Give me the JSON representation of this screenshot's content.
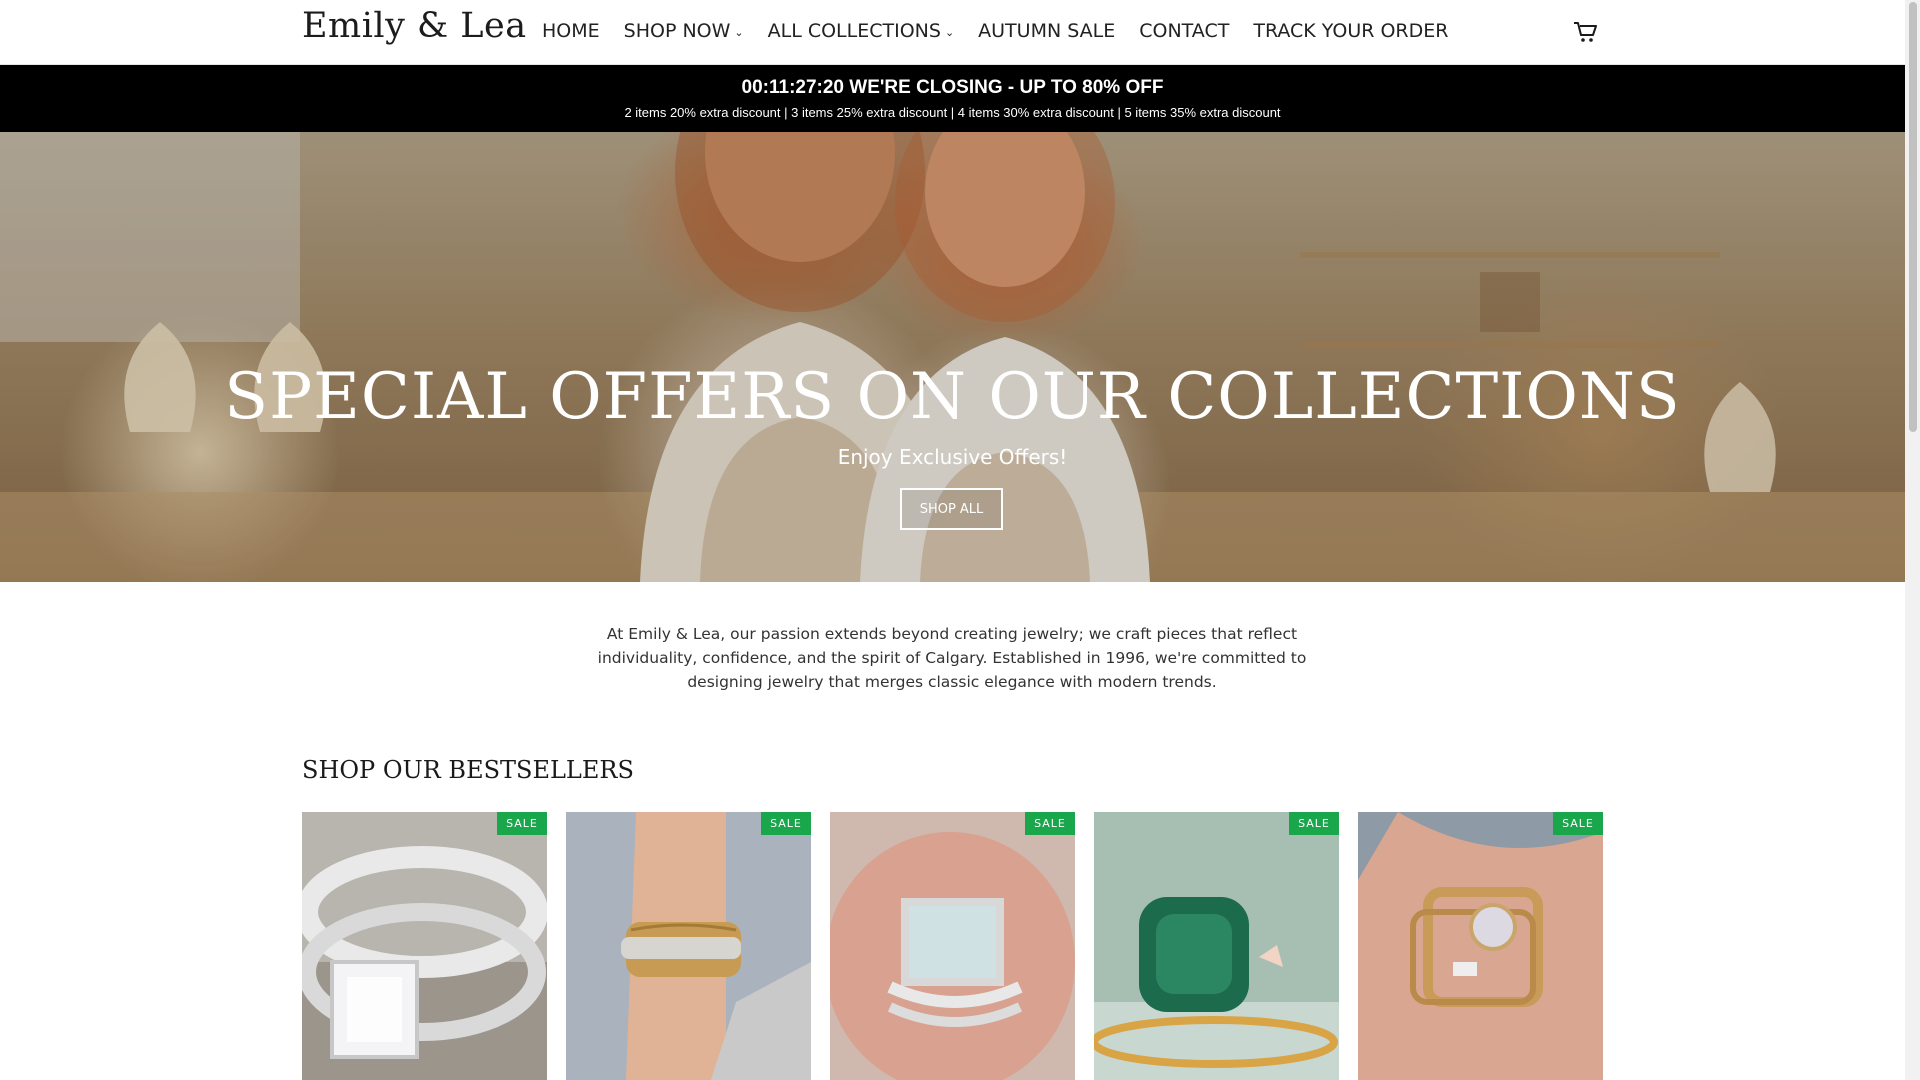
{
  "header": {
    "logo": "Emily & Lea",
    "nav": [
      {
        "label": "HOME",
        "dropdown": false
      },
      {
        "label": "SHOP NOW",
        "dropdown": true
      },
      {
        "label": "ALL COLLECTIONS",
        "dropdown": true
      },
      {
        "label": "AUTUMN SALE",
        "dropdown": false
      },
      {
        "label": "CONTACT",
        "dropdown": false
      },
      {
        "label": "TRACK YOUR ORDER",
        "dropdown": false
      }
    ],
    "cart_icon": "shopping-cart-icon"
  },
  "announcement": {
    "main": "00:11:27:20 WE'RE CLOSING - UP TO 80% OFF",
    "sub": "2 items 20% extra discount | 3 items 25% extra discount | 4 items 30% extra discount | 5 items 35% extra discount"
  },
  "hero": {
    "title": "SPECIAL OFFERS ON OUR COLLECTIONS",
    "subtitle": "Enjoy Exclusive Offers!",
    "button": "SHOP ALL"
  },
  "intro": {
    "text": "At Emily & Lea, our passion extends beyond creating jewelry; we craft pieces that reflect individuality, confidence, and the spirit of Calgary. Established in 1996, we're committed to designing jewelry that merges classic elegance with modern trends."
  },
  "bestsellers": {
    "title": "SHOP OUR BESTSELLERS",
    "products": [
      {
        "badge": "SALE"
      },
      {
        "badge": "SALE"
      },
      {
        "badge": "SALE"
      },
      {
        "badge": "SALE"
      },
      {
        "badge": "SALE"
      }
    ]
  },
  "colors": {
    "announcement_bg": "#000000",
    "sale_badge": "#1aa64b"
  }
}
